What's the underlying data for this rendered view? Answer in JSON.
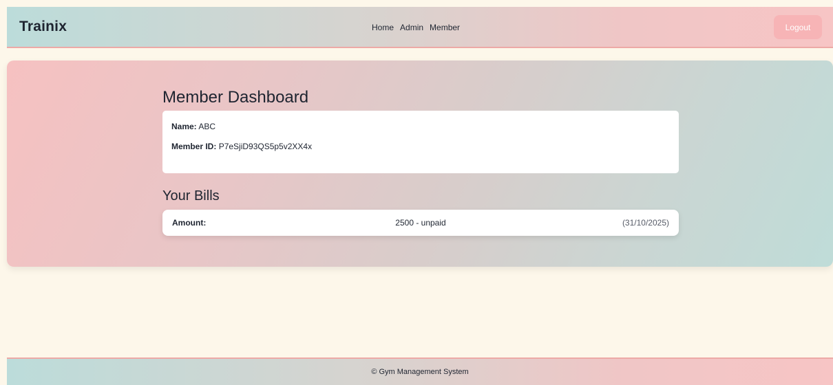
{
  "header": {
    "brand": "Trainix",
    "nav": [
      "Home",
      "Admin",
      "Member"
    ],
    "logout_label": "Logout"
  },
  "dashboard": {
    "title": "Member Dashboard",
    "name_label": "Name:",
    "name_value": "ABC",
    "member_id_label": "Member ID:",
    "member_id_value": "P7eSjiD93QS5p5v2XX4x"
  },
  "bills": {
    "title": "Your Bills",
    "rows": [
      {
        "label": "Amount:",
        "value": "2500 - unpaid",
        "date": "(31/10/2025)"
      }
    ]
  },
  "footer": {
    "text": "© Gym Management System"
  },
  "colors": {
    "page_bg": "#fdf7ea",
    "header_gradient_start": "#bcdcda",
    "header_gradient_end": "#f7c5c5",
    "logout_bg": "#f7b4b6",
    "hero_gradient_start": "#f6c1c1",
    "hero_gradient_end": "#bfdcd8"
  }
}
